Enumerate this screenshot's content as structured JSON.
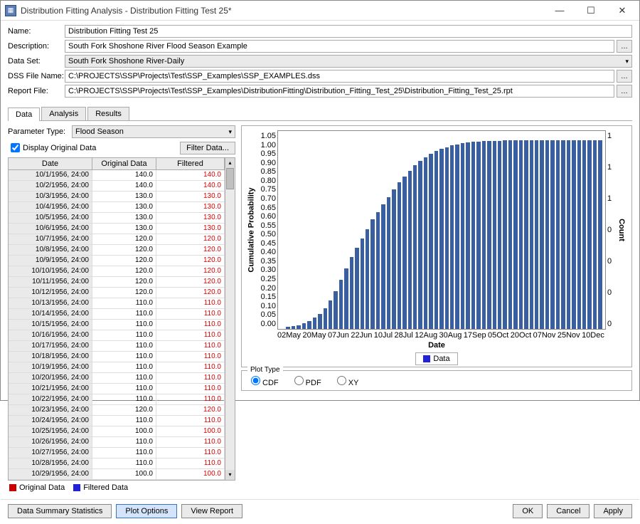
{
  "window": {
    "title": "Distribution Fitting Analysis - Distribution Fitting Test 25*"
  },
  "form": {
    "name_label": "Name:",
    "name_value": "Distribution Fitting Test 25",
    "desc_label": "Description:",
    "desc_value": "South Fork Shoshone River Flood Season Example",
    "dataset_label": "Data Set:",
    "dataset_value": "South Fork Shoshone River-Daily",
    "dssfile_label": "DSS File Name:",
    "dssfile_value": "C:\\PROJECTS\\SSP\\Projects\\Test\\SSP_Examples\\SSP_EXAMPLES.dss",
    "report_label": "Report File:",
    "report_value": "C:\\PROJECTS\\SSP\\Projects\\Test\\SSP_Examples\\DistributionFitting\\Distribution_Fitting_Test_25\\Distribution_Fitting_Test_25.rpt"
  },
  "tabs": {
    "t0": "Data",
    "t1": "Analysis",
    "t2": "Results"
  },
  "params": {
    "paramtype_label": "Parameter Type:",
    "paramtype_value": "Flood Season",
    "display_label": "Display Original Data",
    "filter_btn": "Filter Data..."
  },
  "table": {
    "headers": {
      "date": "Date",
      "orig": "Original Data",
      "filt": "Filtered"
    },
    "rows": [
      {
        "d": "10/1/1956, 24:00",
        "o": "140.0",
        "f": "140.0"
      },
      {
        "d": "10/2/1956, 24:00",
        "o": "140.0",
        "f": "140.0"
      },
      {
        "d": "10/3/1956, 24:00",
        "o": "130.0",
        "f": "130.0"
      },
      {
        "d": "10/4/1956, 24:00",
        "o": "130.0",
        "f": "130.0"
      },
      {
        "d": "10/5/1956, 24:00",
        "o": "130.0",
        "f": "130.0"
      },
      {
        "d": "10/6/1956, 24:00",
        "o": "130.0",
        "f": "130.0"
      },
      {
        "d": "10/7/1956, 24:00",
        "o": "120.0",
        "f": "120.0"
      },
      {
        "d": "10/8/1956, 24:00",
        "o": "120.0",
        "f": "120.0"
      },
      {
        "d": "10/9/1956, 24:00",
        "o": "120.0",
        "f": "120.0"
      },
      {
        "d": "10/10/1956, 24:00",
        "o": "120.0",
        "f": "120.0"
      },
      {
        "d": "10/11/1956, 24:00",
        "o": "120.0",
        "f": "120.0"
      },
      {
        "d": "10/12/1956, 24:00",
        "o": "120.0",
        "f": "120.0"
      },
      {
        "d": "10/13/1956, 24:00",
        "o": "110.0",
        "f": "110.0"
      },
      {
        "d": "10/14/1956, 24:00",
        "o": "110.0",
        "f": "110.0"
      },
      {
        "d": "10/15/1956, 24:00",
        "o": "110.0",
        "f": "110.0"
      },
      {
        "d": "10/16/1956, 24:00",
        "o": "110.0",
        "f": "110.0"
      },
      {
        "d": "10/17/1956, 24:00",
        "o": "110.0",
        "f": "110.0"
      },
      {
        "d": "10/18/1956, 24:00",
        "o": "110.0",
        "f": "110.0"
      },
      {
        "d": "10/19/1956, 24:00",
        "o": "110.0",
        "f": "110.0"
      },
      {
        "d": "10/20/1956, 24:00",
        "o": "110.0",
        "f": "110.0"
      },
      {
        "d": "10/21/1956, 24:00",
        "o": "110.0",
        "f": "110.0"
      },
      {
        "d": "10/22/1956, 24:00",
        "o": "110.0",
        "f": "110.0"
      },
      {
        "d": "10/23/1956, 24:00",
        "o": "120.0",
        "f": "120.0"
      },
      {
        "d": "10/24/1956, 24:00",
        "o": "110.0",
        "f": "110.0"
      },
      {
        "d": "10/25/1956, 24:00",
        "o": "100.0",
        "f": "100.0"
      },
      {
        "d": "10/26/1956, 24:00",
        "o": "110.0",
        "f": "110.0"
      },
      {
        "d": "10/27/1956, 24:00",
        "o": "110.0",
        "f": "110.0"
      },
      {
        "d": "10/28/1956, 24:00",
        "o": "110.0",
        "f": "110.0"
      },
      {
        "d": "10/29/1956, 24:00",
        "o": "100.0",
        "f": "100.0"
      }
    ]
  },
  "legend": {
    "orig": "Original Data",
    "filt": "Filtered Data"
  },
  "chart_data": {
    "type": "bar",
    "title": "",
    "xlabel": "Date",
    "ylabel": "Cumulative Probability",
    "ylabel2": "Count",
    "ylim": [
      0,
      1.05
    ],
    "yticks": [
      "1.05",
      "1.00",
      "0.95",
      "0.90",
      "0.85",
      "0.80",
      "0.75",
      "0.70",
      "0.65",
      "0.60",
      "0.55",
      "0.50",
      "0.45",
      "0.40",
      "0.35",
      "0.30",
      "0.25",
      "0.20",
      "0.15",
      "0.10",
      "0.05",
      "0.00"
    ],
    "y2ticks": [
      "1",
      "1",
      "1",
      "0",
      "0",
      "0",
      "0"
    ],
    "xticks": [
      "02May",
      "20May",
      "07Jun",
      "22Jun",
      "10Jul",
      "28Jul",
      "12Aug",
      "30Aug",
      "17Sep",
      "05Oct",
      "20Oct",
      "07Nov",
      "25Nov",
      "10Dec"
    ],
    "series": [
      {
        "name": "Data",
        "values": [
          0.0,
          0.01,
          0.015,
          0.02,
          0.03,
          0.04,
          0.06,
          0.08,
          0.11,
          0.15,
          0.2,
          0.26,
          0.32,
          0.38,
          0.43,
          0.48,
          0.53,
          0.58,
          0.62,
          0.66,
          0.7,
          0.74,
          0.78,
          0.81,
          0.84,
          0.87,
          0.89,
          0.91,
          0.93,
          0.945,
          0.955,
          0.965,
          0.975,
          0.98,
          0.985,
          0.99,
          0.993,
          0.995,
          0.997,
          0.998,
          0.999,
          0.999,
          1.0,
          1.0,
          1.0,
          1.0,
          1.0,
          1.0,
          1.0,
          1.0,
          1.0,
          1.0,
          1.0,
          1.0,
          1.0,
          1.0,
          1.0,
          1.0,
          1.0,
          1.0,
          1.0
        ]
      }
    ],
    "legend_label": "Data"
  },
  "plottype": {
    "title": "Plot Type",
    "opts": {
      "cdf": "CDF",
      "pdf": "PDF",
      "xy": "XY"
    },
    "selected": "cdf"
  },
  "buttons": {
    "summary": "Data Summary Statistics",
    "plotopts": "Plot Options",
    "viewreport": "View Report",
    "ok": "OK",
    "cancel": "Cancel",
    "apply": "Apply"
  }
}
